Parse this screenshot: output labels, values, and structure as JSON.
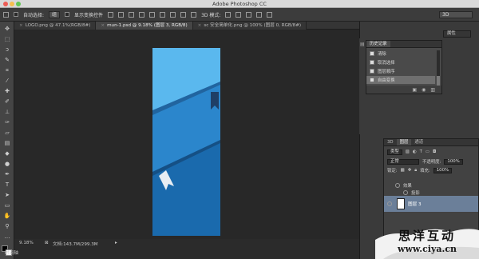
{
  "window": {
    "title": "Adobe Photoshop CC"
  },
  "options_bar": {
    "auto_select_label": "自动选择:",
    "auto_select_value": "组",
    "show_transform_label": "显示变换控件",
    "mode_3d_label": "3D 模式:",
    "workspace_value": "3D"
  },
  "tabs": [
    {
      "label": "LOGO.png @ 47.1%(RGB/8#)"
    },
    {
      "label": "mun-1.psd @ 9.18% (图层 3, RGB/8)"
    },
    {
      "label": "sc 安全简单化.png @ 100% (图层 0, RGB/8#)"
    }
  ],
  "status": {
    "zoom": "9.18%",
    "doc_info": "文档:143.7M/299.3M",
    "timeline_label": "时间轴"
  },
  "history_panel": {
    "tab_label": "历史记录",
    "items": [
      {
        "label": "清除"
      },
      {
        "label": "取消选择"
      },
      {
        "label": "图层顺序"
      },
      {
        "label": "自由变换"
      }
    ],
    "selected_index": 3
  },
  "properties_panel": {
    "tab_label": "属性"
  },
  "layers_panel": {
    "tabs": [
      {
        "label": "3D"
      },
      {
        "label": "图层"
      },
      {
        "label": "通道"
      }
    ],
    "kind_filter": "类型",
    "blend_mode": "正常",
    "opacity_label": "不透明度:",
    "opacity_value": "100%",
    "lock_label": "锁定:",
    "fill_label": "填充:",
    "fill_value": "100%",
    "effects_label": "效果",
    "shadow_label": "投影",
    "selected_layer": "图层 3"
  },
  "watermark": {
    "title": "思洋互动",
    "url": "www.ciya.cn"
  },
  "colors": {
    "artboard_top": "#5ab8ee",
    "artboard_mid": "#2b86cc",
    "artboard_bottom": "#1a6aad",
    "ribbon_dark": "#1f3f66",
    "ribbon_light": "#e8eef3"
  },
  "tool_icons": [
    "move-icon",
    "marquee-icon",
    "lasso-icon",
    "quick-select-icon",
    "crop-icon",
    "eyedropper-icon",
    "healing-icon",
    "brush-icon",
    "stamp-icon",
    "history-brush-icon",
    "eraser-icon",
    "gradient-icon",
    "blur-icon",
    "dodge-icon",
    "pen-icon",
    "type-icon",
    "path-select-icon",
    "shape-icon",
    "hand-icon",
    "zoom-icon"
  ]
}
